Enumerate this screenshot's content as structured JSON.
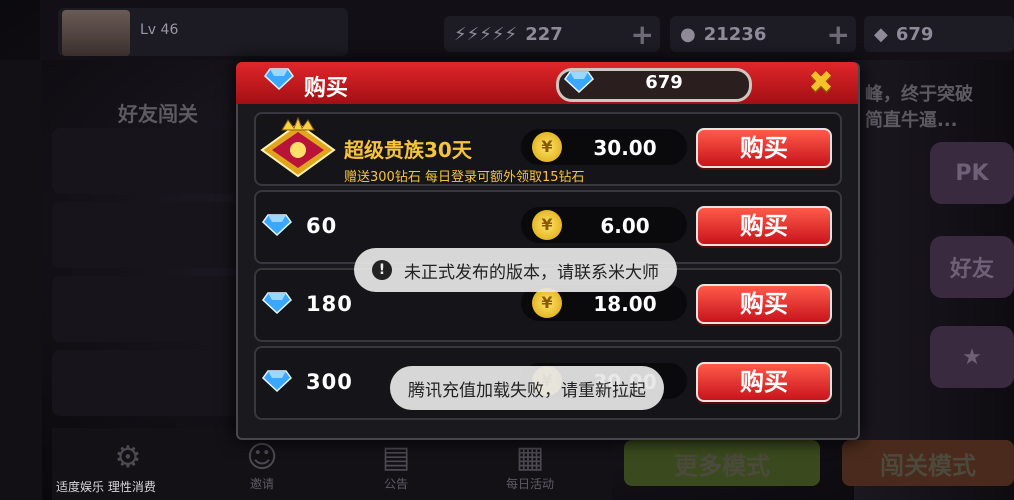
{
  "player": {
    "level": "Lv 46"
  },
  "resources": {
    "energy": "227",
    "coins": "21236",
    "gems": "679"
  },
  "background": {
    "left_title": "好友闯关",
    "right_text_1": "峰，终于突破",
    "right_text_2": "简直牛逼..."
  },
  "modal": {
    "title": "购买",
    "balance": "679",
    "close_icon": "close-x-icon"
  },
  "items": [
    {
      "kind": "vip",
      "title": "超级贵族30天",
      "subtitle": "赠送300钻石  每日登录可额外领取15钻石",
      "price": "30.00",
      "buy_label": "购买"
    },
    {
      "kind": "gems",
      "quantity": "60",
      "price": "6.00",
      "buy_label": "购买"
    },
    {
      "kind": "gems",
      "quantity": "180",
      "price": "18.00",
      "buy_label": "购买"
    },
    {
      "kind": "gems",
      "quantity": "300",
      "price": "30.00",
      "buy_label": "购买"
    }
  ],
  "coin_symbol": "¥",
  "toasts": {
    "warning": "未正式发布的版本，请联系米大师",
    "error": "腾讯充值加载失败，请重新拉起"
  },
  "nav": {
    "invite": "邀请",
    "notice": "公告",
    "daily": "每日活动"
  },
  "modes": {
    "more": "更多模式",
    "stage": "闯关模式"
  },
  "footer": "适度娱乐  理性消费",
  "colors": {
    "header_red": "#d11f24",
    "gold": "#f7c33a",
    "buy_red": "#e0262a"
  }
}
